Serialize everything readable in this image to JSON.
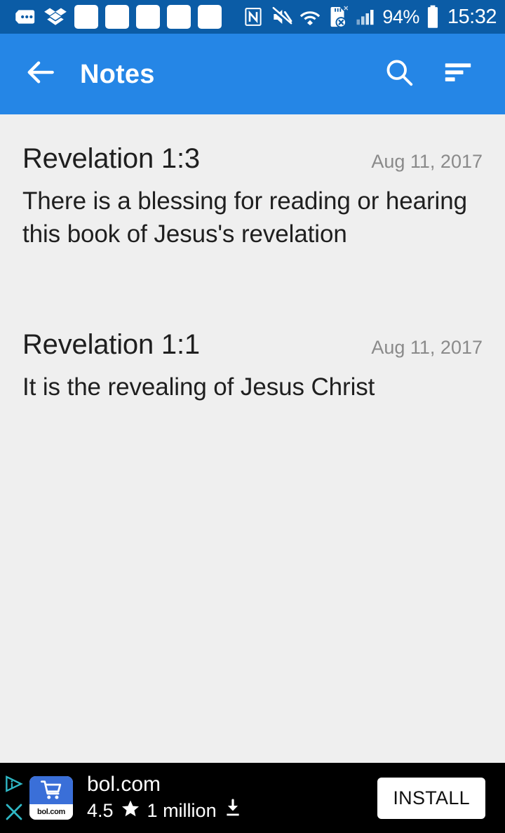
{
  "status_bar": {
    "background_color": "#0b5ca6",
    "left_icons": [
      {
        "name": "more-notifications-icon",
        "glyph": "dots"
      },
      {
        "name": "dropbox-icon",
        "glyph": "dropbox"
      },
      {
        "name": "notification-placeholder-icon",
        "glyph": "square"
      },
      {
        "name": "notification-placeholder-icon",
        "glyph": "square"
      },
      {
        "name": "notification-placeholder-icon",
        "glyph": "square"
      },
      {
        "name": "notification-placeholder-icon",
        "glyph": "square"
      },
      {
        "name": "notification-placeholder-icon",
        "glyph": "square"
      }
    ],
    "right_icons": [
      {
        "name": "nfc-icon"
      },
      {
        "name": "sound-muted-icon"
      },
      {
        "name": "wifi-icon"
      },
      {
        "name": "sd-card-error-icon"
      },
      {
        "name": "cellular-signal-icon"
      }
    ],
    "battery_percent": "94%",
    "clock": "15:32"
  },
  "app_bar": {
    "background_color": "#2586e6",
    "title": "Notes",
    "back_icon": "arrow-back-icon",
    "search_icon": "search-icon",
    "sort_icon": "sort-icon"
  },
  "notes": [
    {
      "title": "Revelation 1:3",
      "date": "Aug 11, 2017",
      "body": "There is a blessing for reading or hearing this book of Jesus's revelation"
    },
    {
      "title": "Revelation 1:1",
      "date": "Aug 11, 2017",
      "body": "It is the revealing of Jesus Christ"
    }
  ],
  "ad": {
    "background_color": "#000000",
    "adchoices_icon": "adchoices-icon",
    "close_icon": "close-icon",
    "app_icon_label": "bol.com",
    "app_name": "bol.com",
    "rating": "4.5",
    "star_icon": "star-icon",
    "downloads": "1 million",
    "download_icon": "download-icon",
    "install_label": "INSTALL"
  }
}
